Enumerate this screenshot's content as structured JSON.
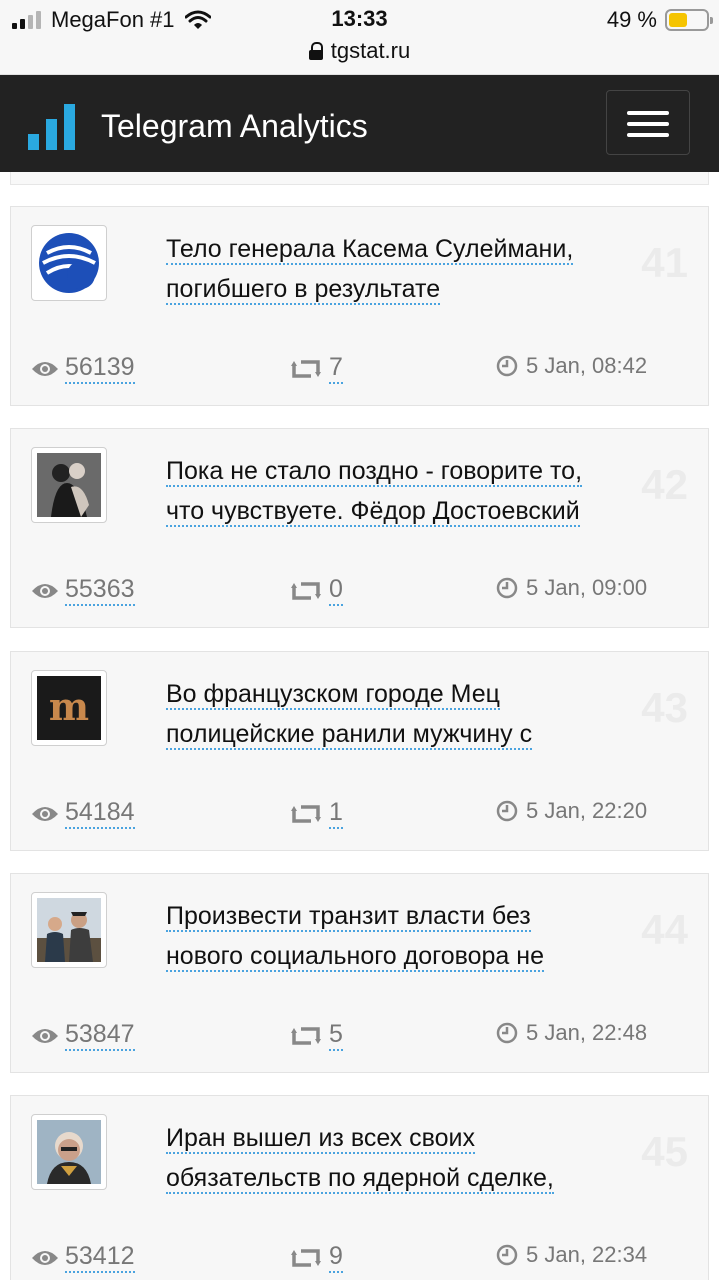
{
  "status_bar": {
    "carrier": "MegaFon #1",
    "time": "13:33",
    "battery": "49 %",
    "battery_level": 0.49,
    "url": "tgstat.ru"
  },
  "header": {
    "brand": "Telegram Analytics",
    "accent_color": "#2aa9e0"
  },
  "posts": [
    {
      "rank": "41",
      "title_line1": "Тело генерала Касема Сулеймани,",
      "title_line2": "погибшего в результате",
      "views": "56139",
      "reposts": "7",
      "date": "5 Jan, 08:42",
      "avatar": "globe-logo"
    },
    {
      "rank": "42",
      "title_line1": "Пока не стало поздно - говорите то,",
      "title_line2": "что чувствуете. Фёдор Достоевский",
      "views": "55363",
      "reposts": "0",
      "date": "5 Jan, 09:00",
      "avatar": "couple-photo"
    },
    {
      "rank": "43",
      "title_line1": "Во французском городе Мец",
      "title_line2": "полицейские ранили мужчину с",
      "views": "54184",
      "reposts": "1",
      "date": "5 Jan, 22:20",
      "avatar": "m-logo"
    },
    {
      "rank": "44",
      "title_line1": "Произвести транзит власти без",
      "title_line2": "нового социального договора не",
      "views": "53847",
      "reposts": "5",
      "date": "5 Jan, 22:48",
      "avatar": "people-photo"
    },
    {
      "rank": "45",
      "title_line1": "Иран вышел из всех своих",
      "title_line2": "обязательств по ядерной сделке,",
      "views": "53412",
      "reposts": "9",
      "date": "5 Jan, 22:34",
      "avatar": "man-photo"
    }
  ]
}
